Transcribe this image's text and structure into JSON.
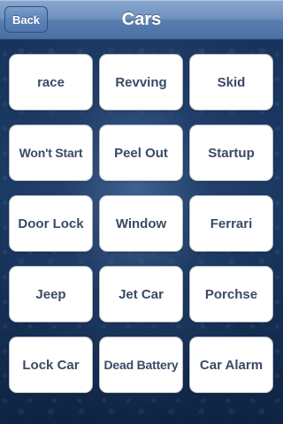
{
  "nav": {
    "back_label": "Back",
    "title": "Cars"
  },
  "buttons": [
    {
      "label": "race"
    },
    {
      "label": "Revving"
    },
    {
      "label": "Skid"
    },
    {
      "label": "Won't Start"
    },
    {
      "label": "Peel Out"
    },
    {
      "label": "Startup"
    },
    {
      "label": "Door Lock"
    },
    {
      "label": "Window"
    },
    {
      "label": "Ferrari"
    },
    {
      "label": "Jeep"
    },
    {
      "label": "Jet Car"
    },
    {
      "label": "Porchse"
    },
    {
      "label": "Lock Car"
    },
    {
      "label": "Dead Battery"
    },
    {
      "label": "Car Alarm"
    }
  ]
}
